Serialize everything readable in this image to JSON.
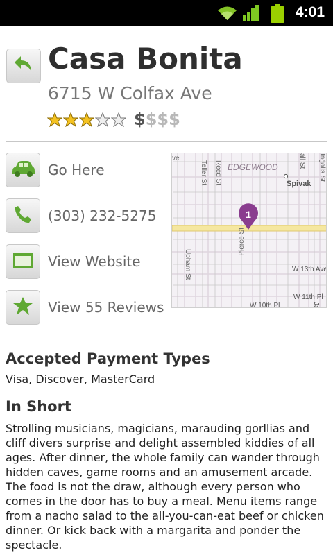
{
  "status_bar": {
    "time": "4:01",
    "icons": [
      "wifi-icon",
      "signal-icon",
      "battery-icon"
    ],
    "colors": {
      "background": "#000000",
      "accent": "#9bd000"
    }
  },
  "place": {
    "name": "Casa Bonita",
    "address": "6715 W Colfax Ave",
    "rating": 3,
    "rating_max": 5,
    "price_active": "$",
    "price_inactive": "$$$",
    "back_icon": "back-arrow-icon"
  },
  "actions": [
    {
      "label": "Go Here",
      "icon": "car-icon"
    },
    {
      "label": "(303) 232-5275",
      "icon": "phone-icon"
    },
    {
      "label": "View Website",
      "icon": "browser-window-icon"
    },
    {
      "label": "View 55 Reviews",
      "icon": "star-icon"
    }
  ],
  "map": {
    "labels": {
      "neighborhood": "EDGEWOOD",
      "place": "Spivak",
      "teller": "Teller St",
      "reed": "Reed St",
      "pierce": "Pierce St",
      "upham": "Upham St",
      "w13": "W 13th Ave",
      "w11": "W 11th Pl",
      "w10": "W 10th Pl",
      "left_edge": "ve",
      "right_edge_1": "all St",
      "right_edge_2": "Ingalls St",
      "right_edge_3": "Ja"
    },
    "marker": "1",
    "colors": {
      "road": "#f5e7a0",
      "marker": "#8a3d8f"
    }
  },
  "payment": {
    "title": "Accepted Payment Types",
    "text": "Visa, Discover, MasterCard"
  },
  "in_short": {
    "title": "In Short",
    "text": "Strolling musicians, magicians, marauding gorllias and cliff divers surprise and delight assembled kiddies of all ages. After dinner, the whole family can wander through hidden caves, game rooms and an amusement arcade. The food is not the draw, although every person who comes in the door has to buy a meal. Menu items range from a nacho salad to the all-you-can-eat beef or chicken dinner. Or kick back with a margarita and ponder the spectacle."
  },
  "ui_colors": {
    "green_icon": "#5fa833",
    "divider": "#c7c7c7"
  }
}
